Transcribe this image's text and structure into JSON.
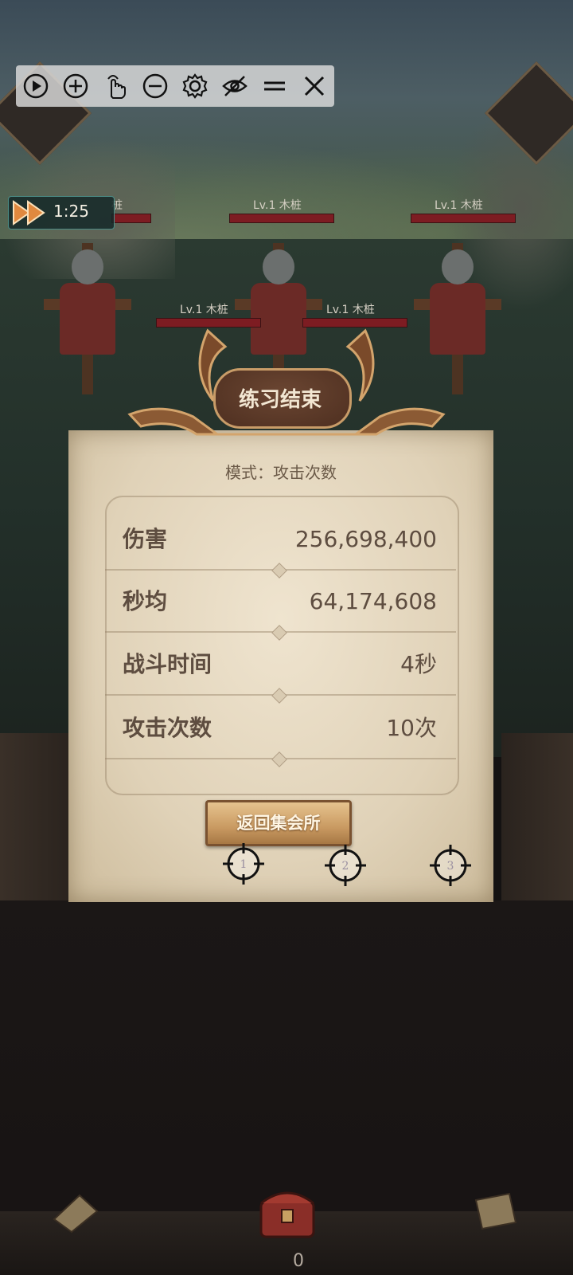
{
  "toolbar": {
    "buttons": [
      {
        "icon": "play-circle-icon"
      },
      {
        "icon": "zoom-in-icon"
      },
      {
        "icon": "tap-gesture-icon"
      },
      {
        "icon": "zoom-out-icon"
      },
      {
        "icon": "gear-icon"
      },
      {
        "icon": "eye-off-icon"
      },
      {
        "icon": "menu-icon"
      },
      {
        "icon": "close-icon"
      }
    ]
  },
  "timer": {
    "text": "1:25"
  },
  "enemies": [
    {
      "label": "桩"
    },
    {
      "label": "Lv.1  木桩"
    },
    {
      "label": "Lv.1  木桩"
    },
    {
      "label": "Lv.1  木桩"
    },
    {
      "label": "Lv.1  木桩"
    }
  ],
  "result": {
    "title": "练习结束",
    "mode": "模式：攻击次数",
    "stats": [
      {
        "label": "伤害",
        "value": "256,698,400"
      },
      {
        "label": "秒均",
        "value": "64,174,608"
      },
      {
        "label": "战斗时间",
        "value": "4秒"
      },
      {
        "label": "攻击次数",
        "value": "10次"
      }
    ],
    "return_button": "返回集会所"
  },
  "targets": [
    "1",
    "2",
    "3"
  ],
  "bottom": {
    "count": "0"
  },
  "colors": {
    "panel": "#e6d9c1",
    "title_plate": "#5a3a28",
    "button": "#d1a66e",
    "hp_bar": "#7d1c22"
  }
}
